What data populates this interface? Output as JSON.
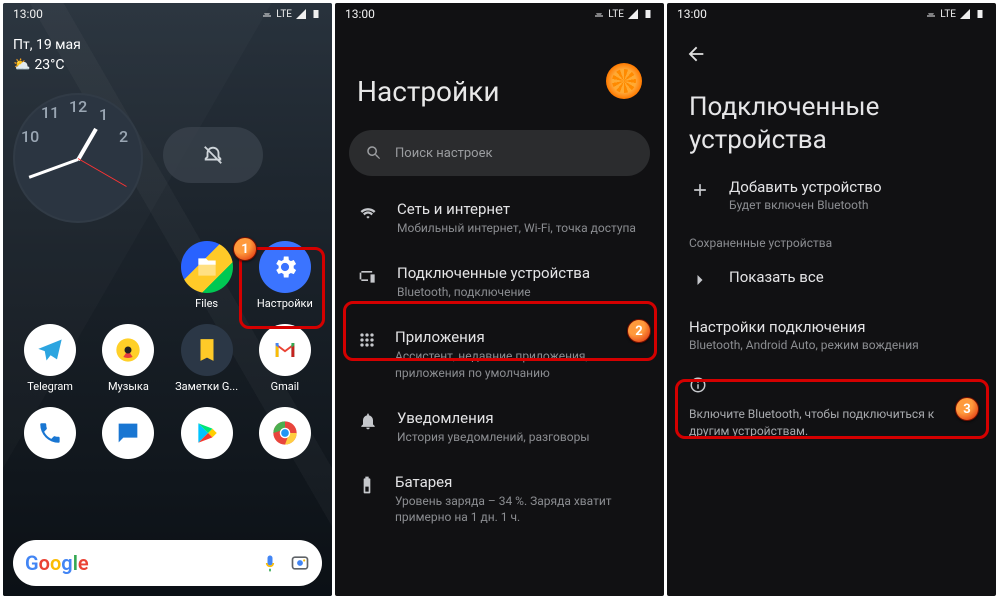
{
  "status": {
    "time": "13:00",
    "net_label": "LTE"
  },
  "panel1": {
    "date": "Пт, 19 мая",
    "temp": "23°C",
    "apps_row1": [
      {
        "name": "Files",
        "label": "Files"
      },
      {
        "name": "Настройки",
        "label": "Настройки"
      }
    ],
    "apps_row2": [
      {
        "name": "Telegram",
        "label": "Telegram"
      },
      {
        "name": "Музыка",
        "label": "Музыка"
      },
      {
        "name": "Заметки G...",
        "label": "Заметки G..."
      },
      {
        "name": "Gmail",
        "label": "Gmail"
      }
    ],
    "badge": "1"
  },
  "panel2": {
    "title": "Настройки",
    "search_placeholder": "Поиск настроек",
    "items": [
      {
        "title": "Сеть и интернет",
        "sub": "Мобильный интернет, Wi-Fi, точка доступа"
      },
      {
        "title": "Подключенные устройства",
        "sub": "Bluetooth, подключение"
      },
      {
        "title": "Приложения",
        "sub": "Ассистент, недавние приложения, приложения по умолчанию"
      },
      {
        "title": "Уведомления",
        "sub": "История уведомлений, разговоры"
      },
      {
        "title": "Батарея",
        "sub": "Уровень заряда – 34 %. Заряда хватит примерно на 1 дн. 1 ч."
      }
    ],
    "badge": "2"
  },
  "panel3": {
    "title": "Подключенные устройства",
    "add": {
      "title": "Добавить устройство",
      "sub": "Будет включен Bluetooth"
    },
    "saved_label": "Сохраненные устройства",
    "show_all": "Показать все",
    "pref": {
      "title": "Настройки подключения",
      "sub": "Bluetooth, Android Auto, режим вождения"
    },
    "info": "Включите Bluetooth, чтобы подключиться к другим устройствам.",
    "badge": "3"
  }
}
